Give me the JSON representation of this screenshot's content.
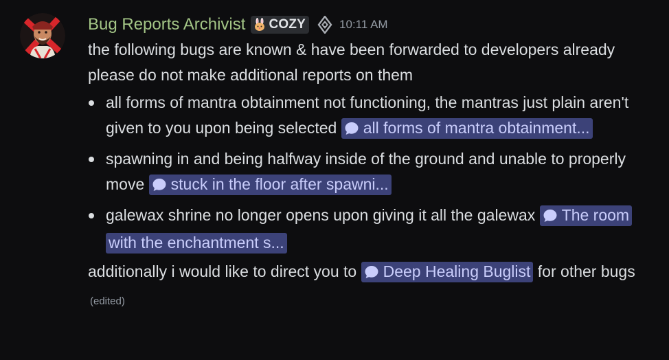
{
  "message": {
    "author": "Bug Reports Archivist",
    "tag": {
      "emoji": "bunny-icon",
      "label": "COZY"
    },
    "role_icon": "role-diamond-icon",
    "timestamp": "10:11 AM",
    "lines": [
      "the following bugs are known & have been forwarded to developers already",
      "please do not make additional reports on them"
    ],
    "bullets": [
      {
        "text": "all forms of mantra obtainment not functioning, the mantras just plain aren't given to you upon being selected ",
        "link": "all forms of mantra obtainment..."
      },
      {
        "text": "spawning in and being halfway inside of the ground and unable to properly move ",
        "link": "stuck in the floor after spawni..."
      },
      {
        "text": "galewax shrine no longer opens upon giving it all the galewax ",
        "link": "The room with the enchantment s..."
      }
    ],
    "footer": {
      "before": "additionally i would like to direct you to ",
      "link": "Deep Healing Buglist",
      "after": " for other bugs",
      "edited": "(edited)"
    }
  },
  "colors": {
    "background": "#0d0d0f",
    "username": "#a3c586",
    "mention_bg": "#3c4278",
    "mention_text": "#c9cdfb",
    "timestamp": "#949ba4"
  }
}
